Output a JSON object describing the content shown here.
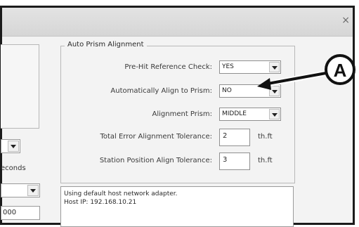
{
  "window": {
    "close_glyph": "×"
  },
  "left_panel": {
    "seconds_partial": "econds",
    "field_partial": "000"
  },
  "group": {
    "title": "Auto Prism Alignment",
    "rows": [
      {
        "label": "Pre-Hit Reference Check:",
        "value": "YES",
        "kind": "dropdown"
      },
      {
        "label": "Automatically Align to Prism:",
        "value": "NO",
        "kind": "dropdown"
      },
      {
        "label": "Alignment Prism:",
        "value": "MIDDLE",
        "kind": "dropdown"
      },
      {
        "label": "Total Error Alignment Tolerance:",
        "value": "2",
        "unit": "th.ft",
        "kind": "text"
      },
      {
        "label": "Station Position Align Tolerance:",
        "value": "3",
        "unit": "th.ft",
        "kind": "text"
      }
    ]
  },
  "log": {
    "line1": "Using default host network adapter.",
    "line2": "Host IP: 192.168.10.21"
  },
  "callout": {
    "letter": "A"
  }
}
